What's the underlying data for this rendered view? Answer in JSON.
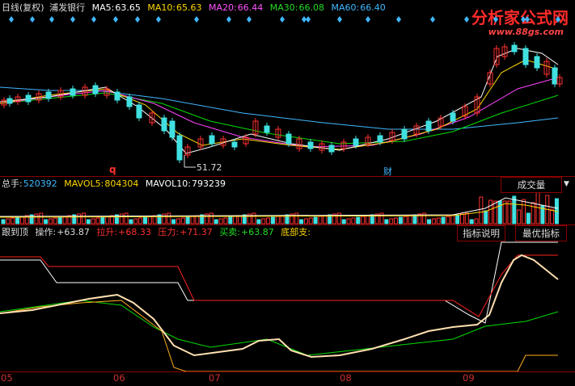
{
  "price_legend": {
    "prefix": "日线(复权)",
    "stock_name": "浦发银行",
    "ma5_label": "MA5:",
    "ma5_value": "63.65",
    "ma10_label": "MA10:",
    "ma10_value": "65.63",
    "ma20_label": "MA20:",
    "ma20_value": "66.44",
    "ma30_label": "MA30:",
    "ma30_value": "66.08",
    "ma60_label": "MA60:",
    "ma60_value": "66.40"
  },
  "watermark": {
    "name": "分析家公式网",
    "url": "www.88gs.com"
  },
  "markers": {
    "q_marker": "q",
    "cai_marker": "财",
    "low_price": "51.72"
  },
  "volume_legend": {
    "total_label": "总手:",
    "total_value": "520392",
    "mavol5_label": "MAVOL5:",
    "mavol5_value": "804304",
    "mavol10_label": "MAVOL10:",
    "mavol10_value": "793239"
  },
  "volume_tab": "成交量",
  "indicator_legend": {
    "name": "跟到顶",
    "op_label": "操作:",
    "op_value": "+63.87",
    "lift_label": "拉升:",
    "lift_value": "+68.33",
    "pressure_label": "压力:",
    "pressure_value": "+71.37",
    "trade_label": "买卖:",
    "trade_value": "+63.87",
    "bottom_label": "底部支:"
  },
  "tabs": {
    "explain": "指标说明",
    "best": "最优指标"
  },
  "x_axis": [
    "05",
    "06",
    "07",
    "08",
    "09"
  ],
  "colors": {
    "ma5": "#ffffff",
    "ma10": "#ffd700",
    "ma20": "#ff44ff",
    "ma30": "#00dd00",
    "ma60": "#40b8ff",
    "up_candle": "#ff3030",
    "down_candle": "#40e0e0",
    "border": "#8a0000"
  }
}
